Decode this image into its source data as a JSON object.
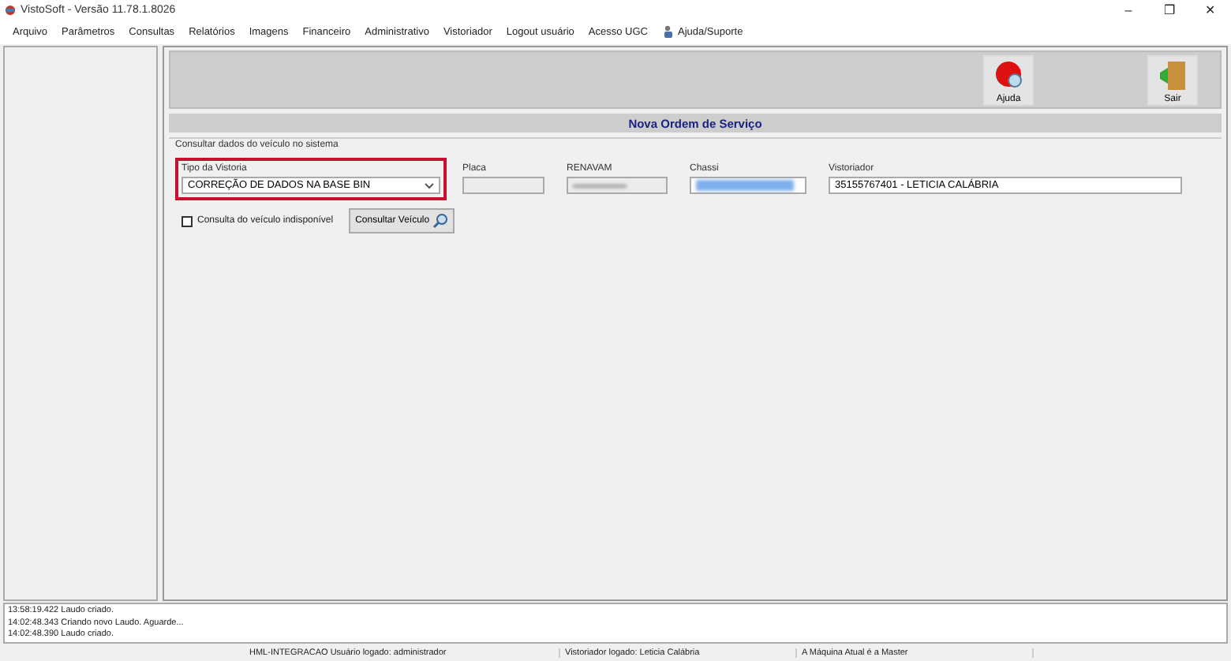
{
  "window": {
    "title": "VistoSoft - Versão 11.78.1.8026",
    "controls": [
      "–",
      "❐",
      "✕"
    ]
  },
  "menu": [
    "Arquivo",
    "Parâmetros",
    "Consultas",
    "Relatórios",
    "Imagens",
    "Financeiro",
    "Administrativo",
    "Vistoriador",
    "Logout usuário",
    "Acesso UGC",
    "Ajuda/Suporte"
  ],
  "toolbar": [
    {
      "kind": "help",
      "label": "Ajuda"
    },
    {
      "kind": "exit",
      "label": "Sair"
    }
  ],
  "form": {
    "title": "Nova Ordem de Serviço",
    "group": "Consultar dados do veículo no sistema",
    "fields": [
      {
        "kind": "select",
        "label": "Tipo da Vistoria",
        "value": "CORREÇÃO DE DADOS NA BASE BIN",
        "highlighted": true
      },
      {
        "kind": "disabled",
        "label": "Placa"
      },
      {
        "kind": "redacted-gray",
        "label": "RENAVAM"
      },
      {
        "kind": "redacted-blue",
        "label": "Chassi"
      },
      {
        "kind": "text",
        "label": "Vistoriador",
        "value": "35155767401 - LETICIA CALÁBRIA"
      }
    ],
    "checkbox": {
      "label": "Consulta do veículo indisponível",
      "checked": false
    },
    "button": "Consultar Veículo"
  },
  "log": [
    "13:58:19.422 Laudo criado.",
    "14:02:48.343 Criando novo Laudo. Aguarde...",
    "14:02:48.390 Laudo criado."
  ],
  "status_bar": [
    "HML-INTEGRACAO Usuário logado: administrador",
    "Vistoriador logado: Leticia Calábria",
    "A Máquina Atual é a Master"
  ]
}
